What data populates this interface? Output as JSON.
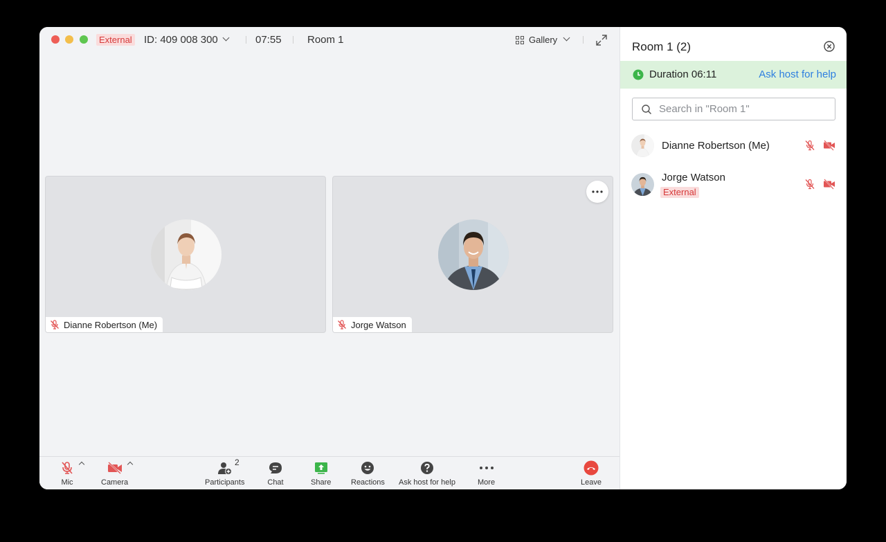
{
  "titlebar": {
    "external_badge": "External",
    "meeting_id": "ID: 409 008 300",
    "timer": "07:55",
    "room": "Room 1",
    "view_mode": "Gallery"
  },
  "tiles": [
    {
      "name": "Dianne Robertson (Me)"
    },
    {
      "name": "Jorge Watson"
    }
  ],
  "toolbar": {
    "mic": "Mic",
    "camera": "Camera",
    "participants": "Participants",
    "participants_count": "2",
    "chat": "Chat",
    "share": "Share",
    "reactions": "Reactions",
    "ask_help": "Ask host for help",
    "more": "More",
    "leave": "Leave"
  },
  "sidebar": {
    "title": "Room 1 (2)",
    "duration": "Duration 06:11",
    "ask_link": "Ask host for help",
    "search_placeholder": "Search in \"Room 1\"",
    "participants": [
      {
        "name": "Dianne Robertson (Me)"
      },
      {
        "name": "Jorge Watson",
        "badge": "External"
      }
    ]
  },
  "colors": {
    "external_badge_bg": "#fadcdc",
    "external_badge_text": "#d63a3a",
    "duration_bar_bg": "#dcf2dc",
    "link": "#2e7fe0",
    "muted_red": "#e25555",
    "leave_red": "#e8483f",
    "share_green": "#3cb54a"
  }
}
